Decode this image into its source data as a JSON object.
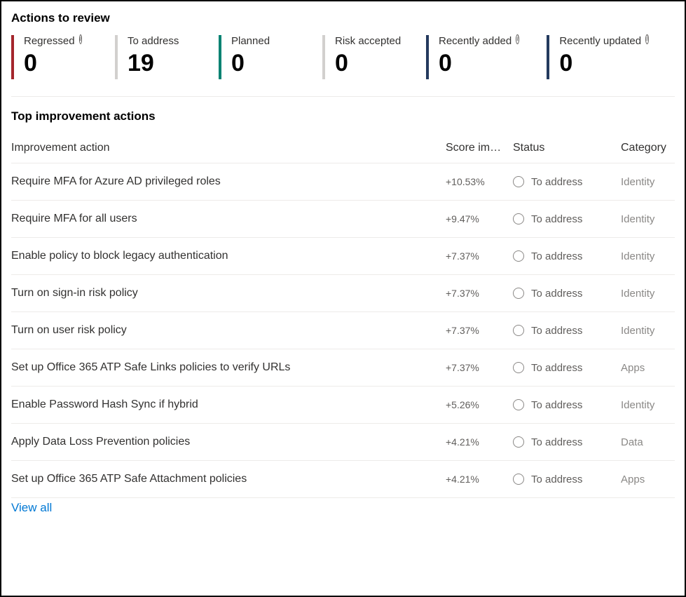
{
  "actions_review": {
    "title": "Actions to review",
    "stats": [
      {
        "label": "Regressed",
        "value": "0",
        "has_info": true,
        "color": "red"
      },
      {
        "label": "To address",
        "value": "19",
        "has_info": false,
        "color": "gray"
      },
      {
        "label": "Planned",
        "value": "0",
        "has_info": false,
        "color": "teal"
      },
      {
        "label": "Risk accepted",
        "value": "0",
        "has_info": false,
        "color": "gray"
      },
      {
        "label": "Recently added",
        "value": "0",
        "has_info": true,
        "color": "navy"
      },
      {
        "label": "Recently updated",
        "value": "0",
        "has_info": true,
        "color": "navy"
      }
    ]
  },
  "improvement_table": {
    "title": "Top improvement actions",
    "headers": {
      "action": "Improvement action",
      "score": "Score im…",
      "status": "Status",
      "category": "Category"
    },
    "rows": [
      {
        "action": "Require MFA for Azure AD privileged roles",
        "score": "+10.53%",
        "status": "To address",
        "category": "Identity"
      },
      {
        "action": "Require MFA for all users",
        "score": "+9.47%",
        "status": "To address",
        "category": "Identity"
      },
      {
        "action": "Enable policy to block legacy authentication",
        "score": "+7.37%",
        "status": "To address",
        "category": "Identity"
      },
      {
        "action": "Turn on sign-in risk policy",
        "score": "+7.37%",
        "status": "To address",
        "category": "Identity"
      },
      {
        "action": "Turn on user risk policy",
        "score": "+7.37%",
        "status": "To address",
        "category": "Identity"
      },
      {
        "action": "Set up Office 365 ATP Safe Links policies to verify URLs",
        "score": "+7.37%",
        "status": "To address",
        "category": "Apps"
      },
      {
        "action": "Enable Password Hash Sync if hybrid",
        "score": "+5.26%",
        "status": "To address",
        "category": "Identity"
      },
      {
        "action": "Apply Data Loss Prevention policies",
        "score": "+4.21%",
        "status": "To address",
        "category": "Data"
      },
      {
        "action": "Set up Office 365 ATP Safe Attachment policies",
        "score": "+4.21%",
        "status": "To address",
        "category": "Apps"
      }
    ],
    "view_all": "View all"
  }
}
